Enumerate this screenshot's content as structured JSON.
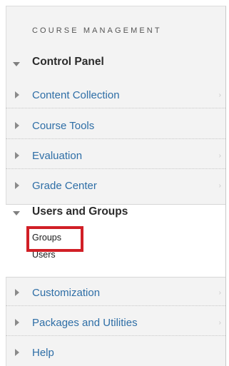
{
  "heading": "COURSE MANAGEMENT",
  "control_panel": {
    "title": "Control Panel"
  },
  "items_top": [
    {
      "label": "Content Collection",
      "chevron": "›"
    },
    {
      "label": "Course Tools",
      "chevron": ""
    },
    {
      "label": "Evaluation",
      "chevron": "›"
    },
    {
      "label": "Grade Center",
      "chevron": "›"
    }
  ],
  "users_and_groups": {
    "title": "Users and Groups",
    "links": [
      "Groups",
      "Users"
    ]
  },
  "items_bottom": [
    {
      "label": "Customization",
      "chevron": "›"
    },
    {
      "label": "Packages and Utilities",
      "chevron": "›"
    },
    {
      "label": "Help",
      "chevron": ""
    }
  ],
  "colors": {
    "link": "#2e6ea6",
    "highlight": "#d11f26",
    "panel_bg": "#f3f3f3"
  }
}
